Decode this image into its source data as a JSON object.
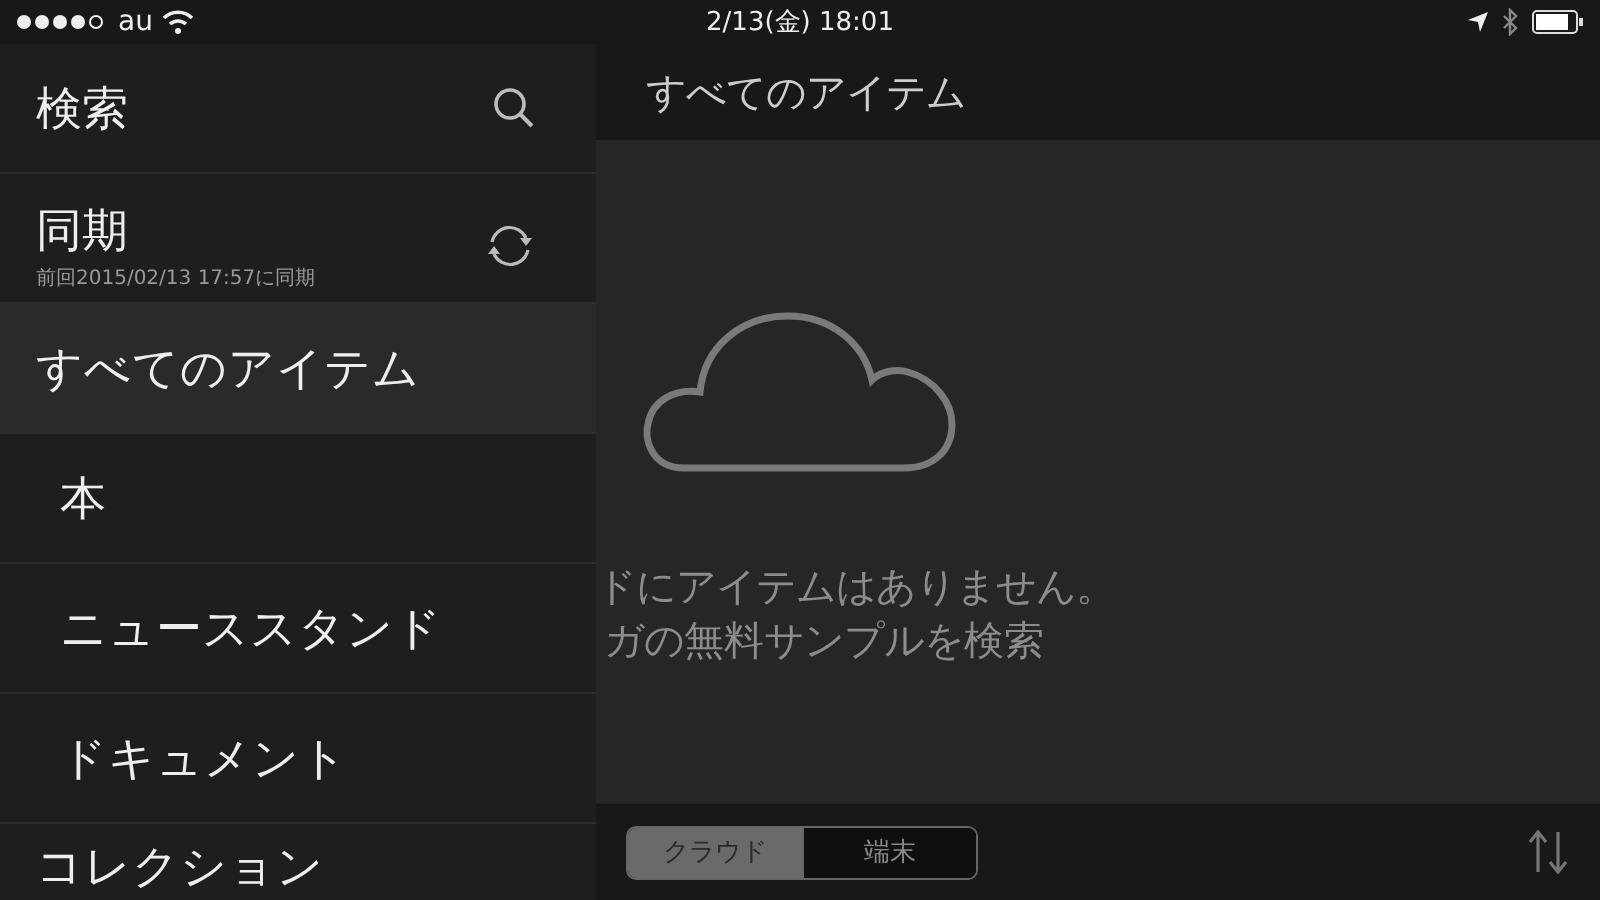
{
  "status_bar": {
    "carrier": "au",
    "time": "2/13(金) 18:01"
  },
  "sidebar": {
    "items": [
      {
        "kind": "search",
        "label": "検索",
        "selected": false
      },
      {
        "kind": "sync",
        "label": "同期",
        "subtitle": "前回2015/02/13 17:57に同期",
        "selected": false
      },
      {
        "kind": "category",
        "label": "すべてのアイテム",
        "selected": true
      },
      {
        "kind": "subcategory",
        "label": "本",
        "selected": false
      },
      {
        "kind": "subcategory",
        "label": "ニューススタンド",
        "selected": false
      },
      {
        "kind": "subcategory",
        "label": "ドキュメント",
        "selected": false
      },
      {
        "kind": "category",
        "label": "コレクション",
        "selected": false
      }
    ]
  },
  "main": {
    "title": "すべてのアイテム",
    "empty_message": [
      "ドにアイテムはありません。",
      "ガの無料サンプルを検索"
    ],
    "segments": [
      {
        "label": "クラウド",
        "selected": true
      },
      {
        "label": "端末",
        "selected": false
      }
    ]
  }
}
